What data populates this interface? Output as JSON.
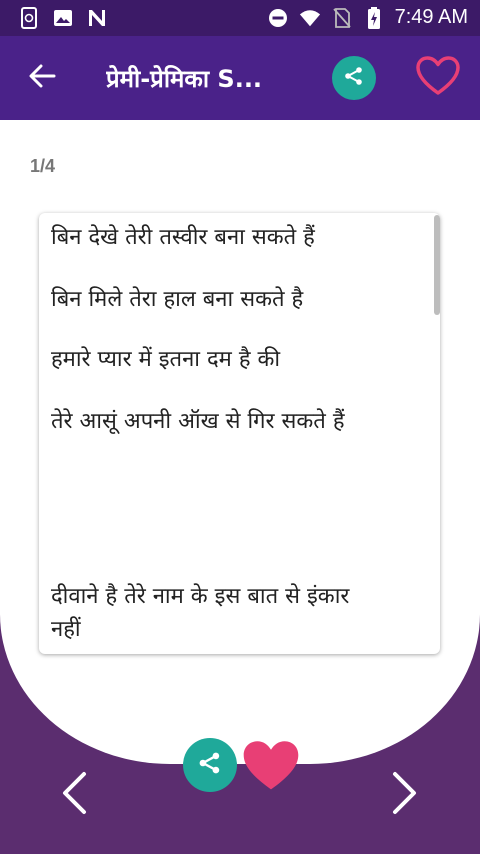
{
  "status_bar": {
    "time": "7:49 AM",
    "icons": [
      "phone-sync-icon",
      "image-icon",
      "n-logo-icon",
      "dnd-icon",
      "wifi-icon",
      "no-sim-icon",
      "battery-charging-icon"
    ]
  },
  "toolbar": {
    "title": "प्रेमी-प्रेमिका S...",
    "back_icon": "arrow-left-icon",
    "share_icon": "share-icon",
    "favorite_icon": "heart-outline-icon"
  },
  "page_counter": "1/4",
  "card": {
    "lines": [
      "बिन देखे तेरी तस्वीर बना सकते हैं",
      "बिन मिले तेरा हाल बना सकते है",
      "हमारे प्यार में इतना दम है की",
      "तेरे आसूं अपनी ऑख से गिर सकते हैं",
      "दीवाने है तेरे नाम के इस बात से इंकार",
      "नहीं"
    ]
  },
  "bottom": {
    "share_icon": "share-icon",
    "favorite_icon": "heart-filled-icon",
    "prev_icon": "chevron-left-icon",
    "next_icon": "chevron-right-icon"
  },
  "colors": {
    "status_bar": "#3c1a67",
    "toolbar": "#4a2289",
    "background": "#5b2d6f",
    "share": "#1fa99a",
    "heart": "#e83f75"
  }
}
